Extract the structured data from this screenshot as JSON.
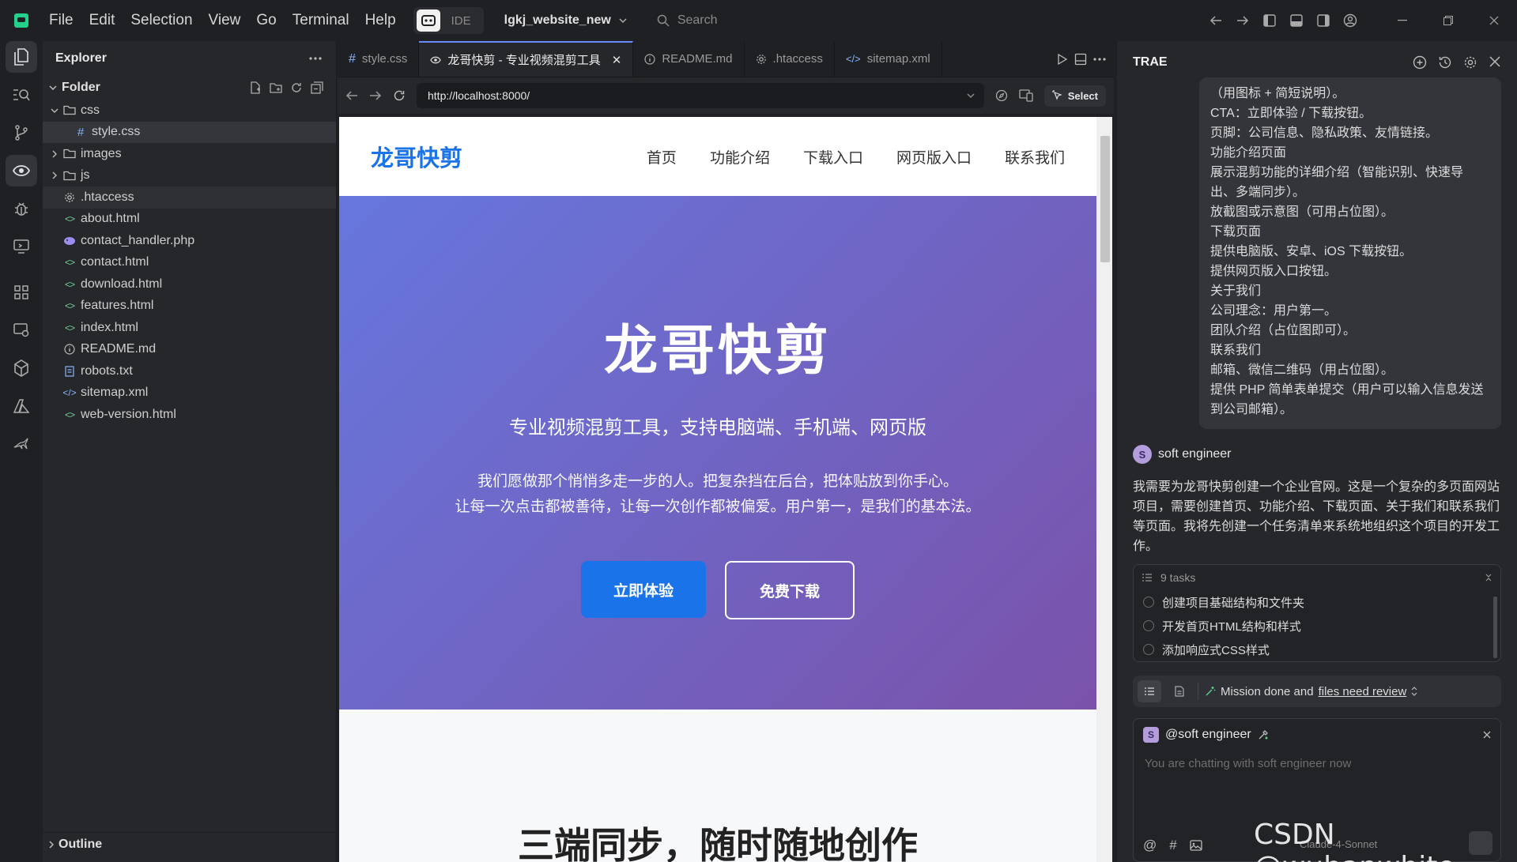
{
  "titlebar": {
    "menu": [
      "File",
      "Edit",
      "Selection",
      "View",
      "Go",
      "Terminal",
      "Help"
    ],
    "ide_label": "IDE",
    "workspace": "lgkj_website_new",
    "search_placeholder": "Search"
  },
  "explorer": {
    "title": "Explorer",
    "root": "Folder",
    "items": [
      {
        "name": "css",
        "type": "folder",
        "open": true,
        "indent": 1
      },
      {
        "name": "style.css",
        "type": "css",
        "indent": 2
      },
      {
        "name": "images",
        "type": "folder",
        "open": false,
        "indent": 1
      },
      {
        "name": "js",
        "type": "folder",
        "open": false,
        "indent": 1
      },
      {
        "name": ".htaccess",
        "type": "gear",
        "indent": 1
      },
      {
        "name": "about.html",
        "type": "html",
        "indent": 1
      },
      {
        "name": "contact_handler.php",
        "type": "php",
        "indent": 1
      },
      {
        "name": "contact.html",
        "type": "html",
        "indent": 1
      },
      {
        "name": "download.html",
        "type": "html",
        "indent": 1
      },
      {
        "name": "features.html",
        "type": "html",
        "indent": 1
      },
      {
        "name": "index.html",
        "type": "html",
        "indent": 1
      },
      {
        "name": "README.md",
        "type": "info",
        "indent": 1
      },
      {
        "name": "robots.txt",
        "type": "txt",
        "indent": 1
      },
      {
        "name": "sitemap.xml",
        "type": "xml",
        "indent": 1
      },
      {
        "name": "web-version.html",
        "type": "html",
        "indent": 1
      }
    ],
    "outline": "Outline"
  },
  "editor": {
    "tabs": [
      {
        "label": "style.css",
        "icon": "hash-icon",
        "active": false
      },
      {
        "label": "龙哥快剪 - 专业视频混剪工具",
        "icon": "eye-icon",
        "active": true
      },
      {
        "label": "README.md",
        "icon": "info-icon",
        "active": false
      },
      {
        "label": ".htaccess",
        "icon": "gear-icon",
        "active": false
      },
      {
        "label": "sitemap.xml",
        "icon": "code-icon",
        "active": false
      }
    ],
    "url": "http://localhost:8000/",
    "select_label": "Select"
  },
  "site": {
    "logo": "龙哥快剪",
    "nav": [
      "首页",
      "功能介绍",
      "下载入口",
      "网页版入口",
      "联系我们"
    ],
    "hero_title": "龙哥快剪",
    "hero_subtitle": "专业视频混剪工具，支持电脑端、手机端、网页版",
    "hero_line1": "我们愿做那个悄悄多走一步的人。把复杂挡在后台，把体贴放到你手心。",
    "hero_line2": "让每一次点击都被善待，让每一次创作都被偏爱。用户第一，是我们的基本法。",
    "btn_try": "立即体验",
    "btn_download": "免费下载",
    "section_title": "三端同步，随时随地创作"
  },
  "ai": {
    "title": "TRAE",
    "user_lines": [
      "（用图标 + 简短说明）。",
      "CTA：立即体验 / 下载按钮。",
      "页脚：公司信息、隐私政策、友情链接。",
      "功能介绍页面",
      "展示混剪功能的详细介绍（智能识别、快速导",
      "出、多端同步）。",
      "放截图或示意图（可用占位图）。",
      "下载页面",
      "提供电脑版、安卓、iOS 下载按钮。",
      "提供网页版入口按钮。",
      "关于我们",
      "公司理念：用户第一。",
      "团队介绍（占位图即可）。",
      "联系我们",
      "邮箱、微信二维码（用占位图）。",
      "提供 PHP 简单表单提交（用户可以输入信息发送",
      "到公司邮箱）。"
    ],
    "agent_avatar": "S",
    "agent_name": "soft engineer",
    "agent_message": "我需要为龙哥快剪创建一个企业官网。这是一个复杂的多页面网站项目，需要创建首页、功能介绍、下载页面、关于我们和联系我们等页面。我将先创建一个任务清单来系统地组织这个项目的开发工作。",
    "tasks_label": "9 tasks",
    "tasks": [
      "创建项目基础结构和文件夹",
      "开发首页HTML结构和样式",
      "添加响应式CSS样式"
    ],
    "status_prefix": "Mission done and",
    "status_link": "files need review",
    "chat_agent": "@soft engineer",
    "chat_placeholder": "You are chatting with soft engineer now",
    "model_label": "Claude-4-Sonnet"
  },
  "watermark": "CSDN @wuhanwhite"
}
